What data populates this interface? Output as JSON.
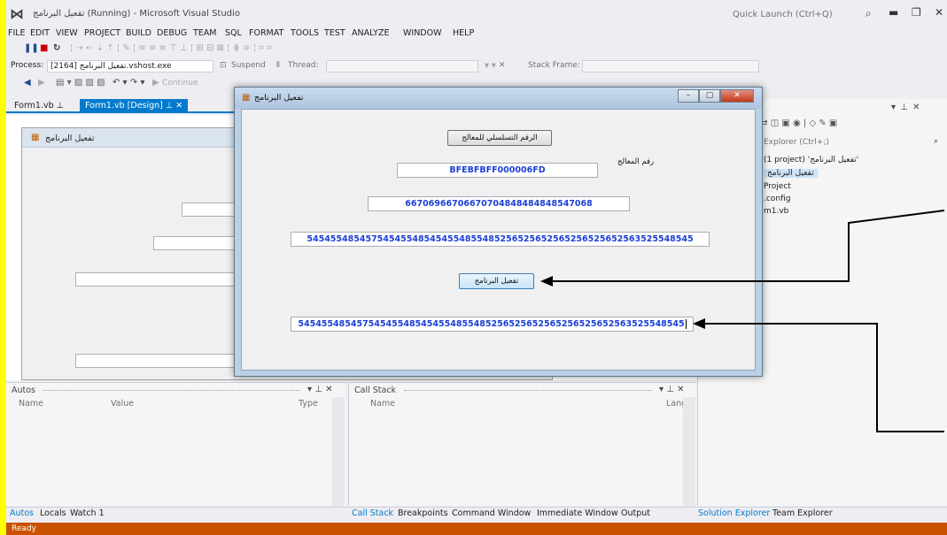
{
  "window": {
    "title": "تفعيل البرنامج (Running) - Microsoft Visual Studio",
    "quick_launch_placeholder": "Quick Launch (Ctrl+Q)"
  },
  "menu": {
    "items": [
      "FILE",
      "EDIT",
      "VIEW",
      "PROJECT",
      "BUILD",
      "DEBUG",
      "TEAM",
      "SQL",
      "FORMAT",
      "TOOLS",
      "TEST",
      "ANALYZE",
      "WINDOW",
      "HELP"
    ]
  },
  "debug_toolbar": {
    "process_label": "Process:",
    "process_value": "[2164] تفعيل البرنامج.vshost.exe",
    "suspend_label": "Suspend",
    "thread_label": "Thread:",
    "stack_frame_label": "Stack Frame:",
    "continue_label": "Continue",
    "return_label": "Return"
  },
  "doc_tabs": {
    "tab1": "Form1.vb",
    "tab2": "Form1.vb [Design]"
  },
  "designer": {
    "form_caption": "تفعيل البرنامج"
  },
  "dialog": {
    "caption": "تفعيل البرنامج",
    "serial_button": "الرقم التسلسلي للمعالج",
    "processor_label": "رقم المعالج",
    "processor_id": "BFEBFBFF000006FD",
    "encoded_value": "66706966706670704848484848547068",
    "long_code": "545455485457545455485454554855485256525652565256525652563525548545",
    "activate_button": "تفعيل البرنامج",
    "entered_code": "545455485457545455485454554855485256525652565256525652563525548545"
  },
  "solution_explorer": {
    "search_placeholder": "Explorer (Ctrl+;)",
    "items": [
      "(1 project) 'تفعيل البرنامج'",
      "تفعيل البرنامج",
      "Project",
      ".config",
      "m1.vb"
    ]
  },
  "autos": {
    "title": "Autos",
    "columns": [
      "Name",
      "Value",
      "Type"
    ]
  },
  "callstack": {
    "title": "Call Stack",
    "columns": [
      "Name",
      "Lang"
    ]
  },
  "bottom_tabs_left": [
    "Autos",
    "Locals",
    "Watch 1"
  ],
  "bottom_tabs_right": [
    "Call Stack",
    "Breakpoints",
    "Command Window",
    "Immediate Window",
    "Output"
  ],
  "side_tabs": [
    "Solution Explorer",
    "Team Explorer"
  ],
  "status": {
    "text": "Ready"
  },
  "colors": {
    "accent": "#007acc",
    "status_bar": "#ca5100",
    "frame": "#ffff00",
    "value_text": "#1c3fd6"
  }
}
